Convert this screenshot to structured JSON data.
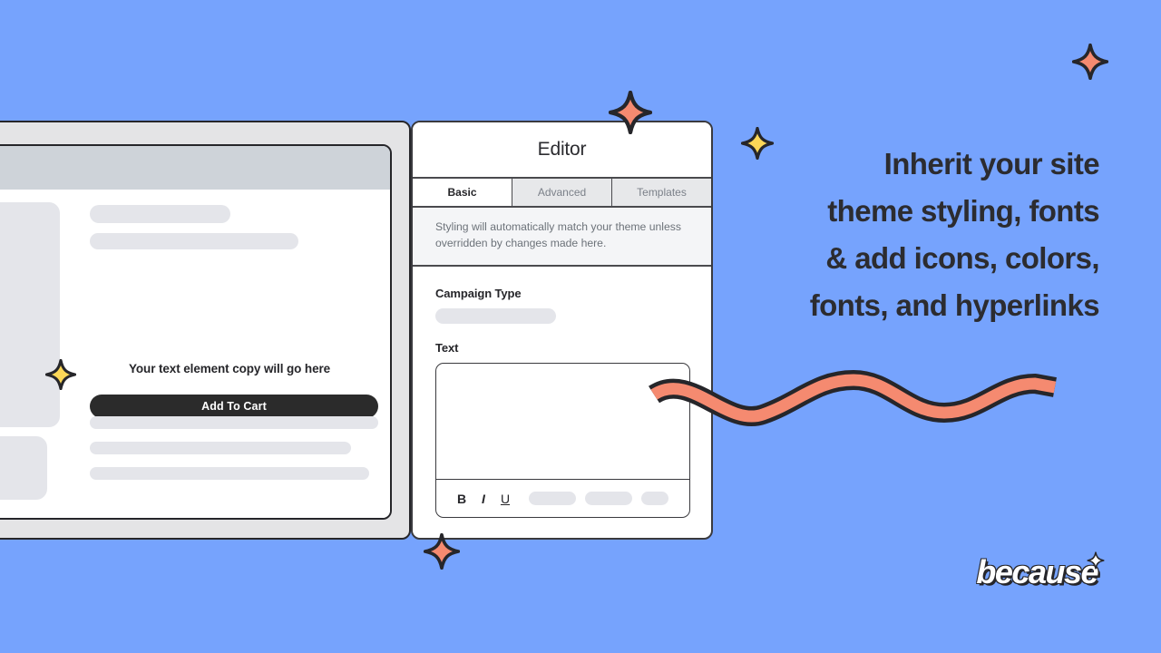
{
  "background_color": "#76a3fd",
  "accent_coral": "#f58a70",
  "accent_yellow": "#fcd757",
  "ink": "#26262a",
  "preview": {
    "text_element_copy": "Your text element copy will go here",
    "cta_label": "Add To Cart"
  },
  "editor": {
    "title": "Editor",
    "tabs": [
      {
        "label": "Basic",
        "active": true
      },
      {
        "label": "Advanced",
        "active": false
      },
      {
        "label": "Templates",
        "active": false
      }
    ],
    "note": "Styling will automatically match your theme unless overridden by changes made here.",
    "fields": {
      "campaign_type_label": "Campaign Type",
      "campaign_type_value": "",
      "text_label": "Text",
      "text_value": ""
    },
    "toolbar": {
      "bold": "B",
      "italic": "I",
      "underline": "U"
    }
  },
  "headline": {
    "line1": "Inherit your site",
    "line2": "theme styling, fonts",
    "line3": "& add icons, colors,",
    "line4": "fonts, and hyperlinks"
  },
  "brand": {
    "name": "because"
  }
}
